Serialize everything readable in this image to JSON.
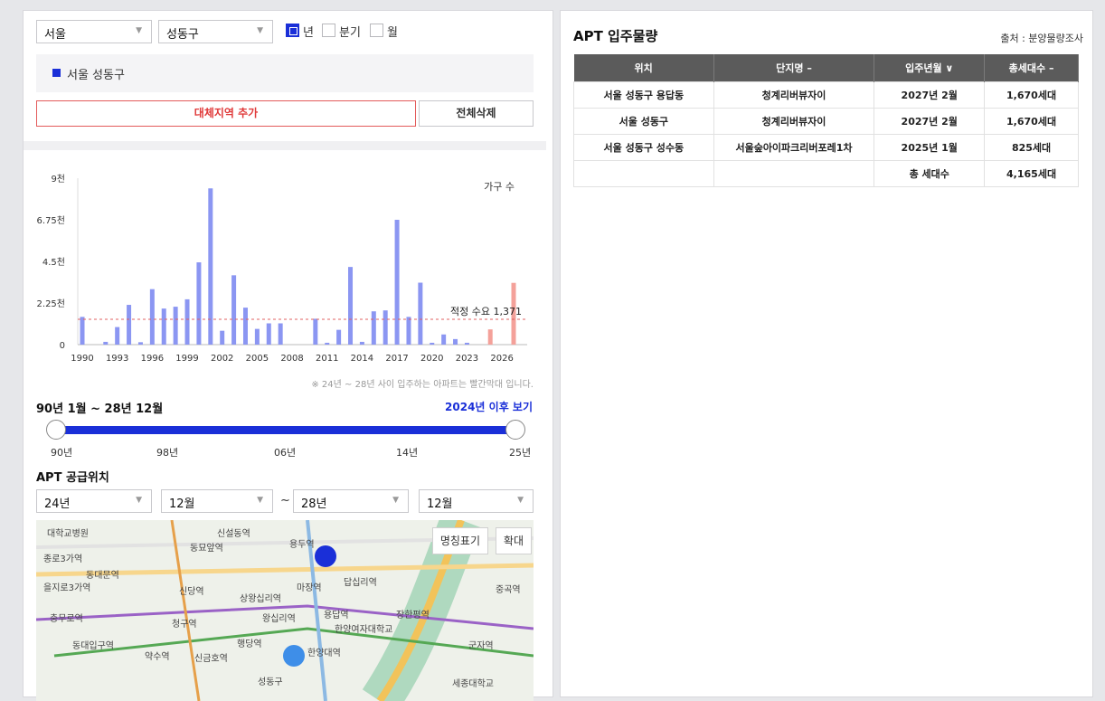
{
  "filters": {
    "city": "서울",
    "district": "성동구",
    "period_options": [
      {
        "label": "년",
        "checked": true
      },
      {
        "label": "분기",
        "checked": false
      },
      {
        "label": "월",
        "checked": false
      }
    ]
  },
  "selected_region": "서울 성동구",
  "buttons": {
    "add_region": "대체지역 추가",
    "delete_all": "전체삭제"
  },
  "chart_data": {
    "type": "bar",
    "legend": "가구 수",
    "ylim": [
      0,
      9000
    ],
    "yticks": [
      "9천",
      "6.75천",
      "4.5천",
      "2.25천",
      "0"
    ],
    "xticks": [
      "1990",
      "1993",
      "1996",
      "1999",
      "2002",
      "2005",
      "2008",
      "2011",
      "2014",
      "2017",
      "2020",
      "2023",
      "2026"
    ],
    "x": [
      1990,
      1991,
      1992,
      1993,
      1994,
      1995,
      1996,
      1997,
      1998,
      1999,
      2000,
      2001,
      2002,
      2003,
      2004,
      2005,
      2006,
      2007,
      2008,
      2009,
      2010,
      2011,
      2012,
      2013,
      2014,
      2015,
      2016,
      2017,
      2018,
      2019,
      2020,
      2021,
      2022,
      2023,
      2024,
      2025,
      2026,
      2027
    ],
    "values": [
      1500,
      0,
      150,
      950,
      2150,
      130,
      3000,
      1950,
      2050,
      2450,
      4450,
      8450,
      750,
      3750,
      2000,
      850,
      1150,
      1150,
      0,
      0,
      1400,
      100,
      800,
      4200,
      150,
      1800,
      1850,
      6750,
      1500,
      3350,
      100,
      550,
      300,
      100,
      0,
      825,
      0,
      3340
    ],
    "highlight_from": 2024,
    "reference_line": {
      "label": "적정 수요 1,371",
      "value": 1371
    },
    "colors": {
      "normal": "#8b96f2",
      "highlight": "#f4a19a",
      "reference": "#e06060"
    }
  },
  "chart_note": "※ 24년 ~ 28년 사이 입주하는 아파트는 빨간막대 입니다.",
  "range": {
    "title": "90년 1월 ~ 28년 12월",
    "link": "2024년 이후 보기",
    "labels": [
      "90년",
      "98년",
      "06년",
      "14년",
      "25년"
    ]
  },
  "supply": {
    "title": "APT 공급위치",
    "from_year": "24년",
    "from_month": "12월",
    "tilde": "~",
    "to_year": "28년",
    "to_month": "12월"
  },
  "map": {
    "controls": [
      "명칭표기",
      "확대"
    ],
    "labels": [
      "대학교병원",
      "신설동역",
      "용두역",
      "종로3가역",
      "동묘앞역",
      "동대문역",
      "답십리역",
      "을지로3가역",
      "신당역",
      "상왕십리역",
      "마장역",
      "충무로역",
      "청구역",
      "왕십리역",
      "용답역",
      "장한평역",
      "한양여자대학교",
      "동대입구역",
      "약수역",
      "신금호역",
      "행당역",
      "한양대역",
      "군자역",
      "세종대학교",
      "중곡역",
      "성동구"
    ]
  },
  "apt": {
    "title": "APT 입주물량",
    "source": "출처 : 분양물량조사",
    "columns": [
      "위치",
      "단지명 –",
      "입주년월 ∨",
      "총세대수 –"
    ],
    "rows": [
      [
        "서울 성동구 용답동",
        "청계리버뷰자이",
        "2027년 2월",
        "1,670세대"
      ],
      [
        "서울 성동구",
        "청계리버뷰자이",
        "2027년 2월",
        "1,670세대"
      ],
      [
        "서울 성동구 성수동",
        "서울숲아이파크리버포레1차",
        "2025년 1월",
        "825세대"
      ]
    ],
    "total_label": "총 세대수",
    "total_value": "4,165세대"
  }
}
